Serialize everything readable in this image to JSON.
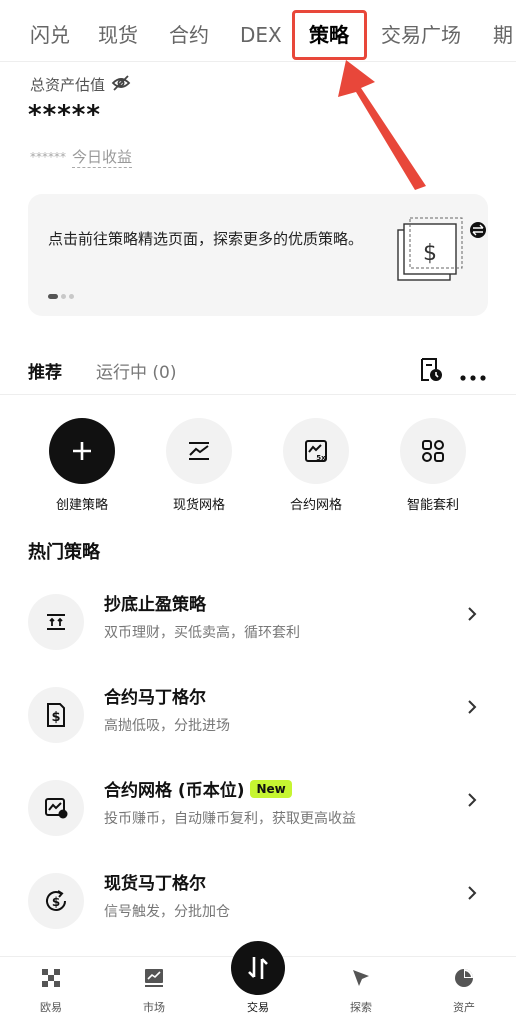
{
  "top_tabs": [
    "闪兑",
    "现货",
    "合约",
    "DEX",
    "策略",
    "交易广场",
    "期"
  ],
  "active_top_tab": "策略",
  "asset": {
    "label": "总资产估值",
    "value": "*****",
    "today_mask": "******",
    "today_label": "今日收益"
  },
  "banner": {
    "text": "点击前往策略精选页面，探索更多的优质策略。"
  },
  "section_tabs": {
    "recommend": "推荐",
    "running": "运行中 (0)"
  },
  "quick_actions": [
    {
      "label": "创建策略",
      "icon": "plus-icon"
    },
    {
      "label": "现货网格",
      "icon": "grid-chart-icon"
    },
    {
      "label": "合约网格",
      "icon": "leverage-chart-icon"
    },
    {
      "label": "智能套利",
      "icon": "arbitrage-icon"
    }
  ],
  "hot_title": "热门策略",
  "strategies": [
    {
      "title": "抄底止盈策略",
      "sub": "双币理财，买低卖高，循环套利",
      "icon": "buy-low-sell-high-icon"
    },
    {
      "title": "合约马丁格尔",
      "sub": "高抛低吸，分批进场",
      "icon": "dollar-doc-icon"
    },
    {
      "title": "合约网格 (币本位)",
      "sub": "投币赚币，自动赚币复利，获取更高收益",
      "badge": "New",
      "icon": "coin-chart-icon"
    },
    {
      "title": "现货马丁格尔",
      "sub": "信号触发，分批加仓",
      "icon": "dollar-cycle-icon"
    }
  ],
  "bottom_nav": [
    "欧易",
    "市场",
    "交易",
    "探索",
    "资产"
  ],
  "colors": {
    "highlight": "#e8473a",
    "new_badge": "#c6f531",
    "dark": "#111111"
  }
}
